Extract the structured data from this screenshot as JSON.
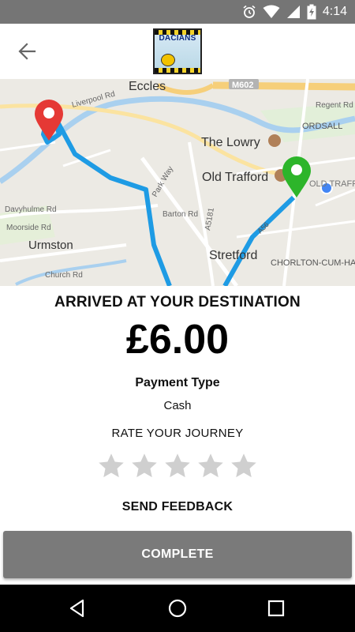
{
  "status": {
    "time": "4:14",
    "icons": [
      "alarm-icon",
      "wifi-icon",
      "signal-icon",
      "battery-charging-icon"
    ]
  },
  "appbar": {
    "logo_text": "DACIANS",
    "back_icon": "arrow-left-icon"
  },
  "map": {
    "labels": {
      "eccles": "Eccles",
      "m602": "M602",
      "regent": "Regent Rd",
      "ordsall": "ORDSALL",
      "liverpool": "Liverpool Rd",
      "lowry": "The Lowry",
      "old_trafford": "Old Trafford",
      "old_traff": "OLD TRAFF",
      "park_way": "Park Way",
      "barton": "Barton Rd",
      "a5181": "A5181",
      "davyhulme": "Davyhulme Rd",
      "moorside": "Moorside Rd",
      "urmston": "Urmston",
      "stretford": "Stretford",
      "chorlton": "CHORLTON-CUM-HA",
      "church": "Church Rd",
      "a56": "A56"
    },
    "route_color": "#1e9be4",
    "start_pin_color": "#e53935",
    "end_pin_color": "#2db52a"
  },
  "trip": {
    "arrived_title": "ARRIVED AT YOUR DESTINATION",
    "price": "£6.00",
    "payment_type_label": "Payment Type",
    "payment_type_value": "Cash",
    "rate_label": "RATE YOUR JOURNEY",
    "rating": 0,
    "rating_max": 5,
    "feedback_label": "SEND FEEDBACK",
    "complete_label": "COMPLETE"
  },
  "navbar": {
    "icons": [
      "back-triangle-icon",
      "home-circle-icon",
      "recents-square-icon"
    ]
  }
}
